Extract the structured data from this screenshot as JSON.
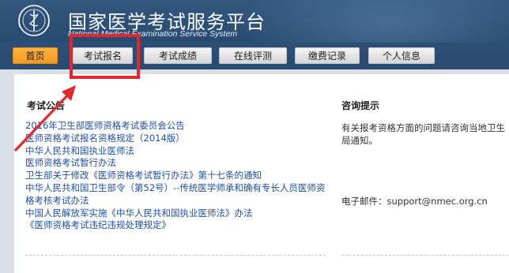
{
  "header": {
    "title": "国家医学考试服务平台",
    "subtitle": "National Medical Examination Service System"
  },
  "nav": {
    "items": [
      {
        "label": "首页",
        "active": true
      },
      {
        "label": "考试报名",
        "active": false
      },
      {
        "label": "考试成绩",
        "active": false
      },
      {
        "label": "在线评测",
        "active": false
      },
      {
        "label": "缴费记录",
        "active": false
      },
      {
        "label": "个人信息",
        "active": false
      }
    ]
  },
  "notices": {
    "title": "考试公告",
    "items": [
      "2016年卫生部医师资格考试委员会公告",
      "医师资格考试报名资格规定（2014版）",
      "中华人民共和国执业医师法",
      "医师资格考试暂行办法",
      "卫生部关于修改《医师资格考试暂行办法》第十七条的通知",
      "中华人民共和国卫生部令（第52号）--传统医学师承和确有专长人员医师资格考核考试办法",
      "中国人民解放军实施《中华人民共和国执业医师法》办法",
      "《医师资格考试违纪违规处理规定》"
    ]
  },
  "consult": {
    "title": "咨询提示",
    "text": "有关报考资格方面的问题请咨询当地卫生局通知。",
    "email_label": "电子邮件：",
    "email": "support@nmec.org.cn"
  },
  "colors": {
    "header_bg": "#2c4f76",
    "active_tab": "#f39a1e",
    "link": "#1f4fa3",
    "annotation": "#e2282c"
  }
}
